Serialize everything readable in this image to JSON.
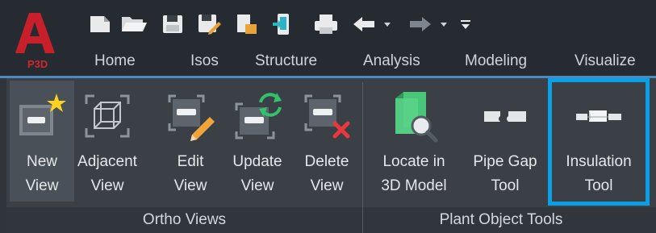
{
  "app": {
    "logo_letter": "A",
    "logo_sub": "P3D",
    "accent_color": "#c8202a"
  },
  "quick_access": [
    {
      "icon": "new-file-icon"
    },
    {
      "icon": "open-folder-icon"
    },
    {
      "icon": "save-icon"
    },
    {
      "icon": "save-as-icon"
    },
    {
      "icon": "import-icon"
    },
    {
      "icon": "export-icon"
    },
    {
      "icon": "print-icon"
    },
    {
      "icon": "undo-icon"
    },
    {
      "icon": "undo-dropdown-icon"
    },
    {
      "icon": "redo-icon"
    },
    {
      "icon": "redo-dropdown-icon"
    },
    {
      "icon": "customize-dropdown-icon"
    }
  ],
  "tabs": [
    {
      "label": "Home"
    },
    {
      "label": "Isos"
    },
    {
      "label": "Structure"
    },
    {
      "label": "Analysis"
    },
    {
      "label": "Modeling"
    },
    {
      "label": "Visualize"
    }
  ],
  "panels": {
    "ortho_views": {
      "title": "Ortho Views",
      "buttons": [
        {
          "line1": "New",
          "line2": "View",
          "icon": "new-view-icon"
        },
        {
          "line1": "Adjacent",
          "line2": "View",
          "icon": "adjacent-view-icon"
        },
        {
          "line1": "Edit",
          "line2": "View",
          "icon": "edit-view-icon"
        },
        {
          "line1": "Update",
          "line2": "View",
          "icon": "update-view-icon"
        },
        {
          "line1": "Delete",
          "line2": "View",
          "icon": "delete-view-icon"
        }
      ]
    },
    "plant_object_tools": {
      "title": "Plant Object Tools",
      "buttons": [
        {
          "line1": "Locate in",
          "line2": "3D Model",
          "icon": "locate-3d-model-icon"
        },
        {
          "line1": "Pipe Gap",
          "line2": "Tool",
          "icon": "pipe-gap-icon"
        },
        {
          "line1": "Insulation",
          "line2": "Tool",
          "icon": "insulation-icon"
        }
      ]
    }
  },
  "highlight_color": "#0aa0e8"
}
